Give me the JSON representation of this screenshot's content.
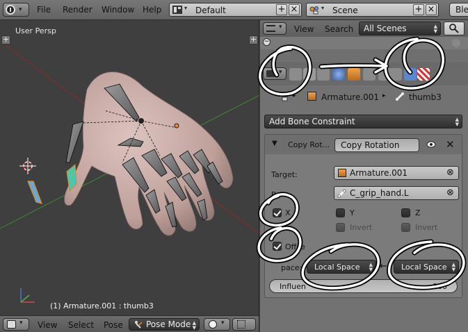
{
  "topbar": {
    "menus": [
      "File",
      "Render",
      "Window",
      "Help"
    ],
    "screen_layout": "Default",
    "scene": "Scene",
    "engine_partial": "Blen"
  },
  "viewport": {
    "view_label": "User Persp",
    "object_info": "(1) Armature.001 : thumb3"
  },
  "viewport_header": {
    "menus": [
      "View",
      "Select",
      "Pose"
    ],
    "mode": "Pose Mode"
  },
  "outliner": {
    "menus": [
      "View",
      "Search"
    ],
    "filter": "All Scenes"
  },
  "properties": {
    "breadcrumb": {
      "object": "Armature.001",
      "bone": "thumb3"
    },
    "add_constraint_label": "Add Bone Constraint",
    "constraint": {
      "type_label": "Copy Rot...",
      "name": "Copy Rotation",
      "target_label": "Target:",
      "target_value": "Armature.001",
      "bone_label_partial": "B",
      "bone_value": "C_grip_hand.L",
      "axes": [
        {
          "label": "X",
          "checked": true,
          "invert_label": ""
        },
        {
          "label": "Y",
          "checked": false,
          "invert_label": "Invert"
        },
        {
          "label": "Z",
          "checked": false,
          "invert_label": "Invert"
        }
      ],
      "offset_label": "Offse",
      "offset_checked": true,
      "space_label_partial": "pace:",
      "owner_space": "Local Space",
      "target_space": "Local Space",
      "influence_label": "Influen",
      "influence_value": "000"
    }
  },
  "colors": {
    "annotation_stroke": "#ffffff",
    "annotation_outline": "#000000",
    "hand_skin": "#c9a9a4",
    "x_axis_line": "#8a2b2b",
    "y_axis_line": "#3c8a2a"
  }
}
